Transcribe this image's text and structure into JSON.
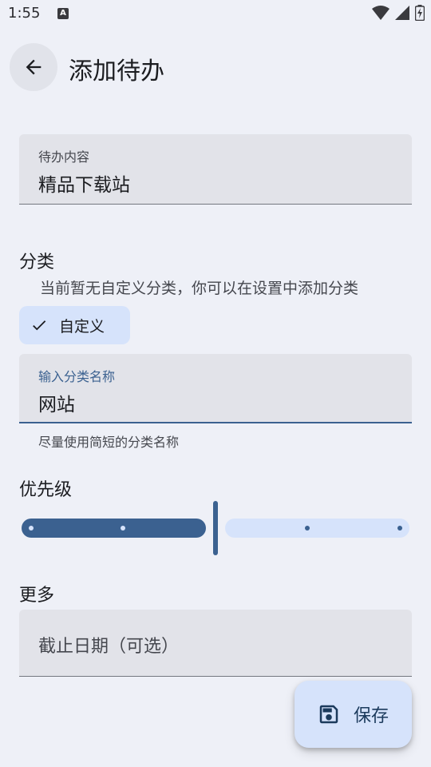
{
  "status_bar": {
    "time": "1:55",
    "a_icon": "A"
  },
  "header": {
    "title": "添加待办"
  },
  "todo_field": {
    "label": "待办内容",
    "value": "精品下载站"
  },
  "category": {
    "title": "分类",
    "hint": "当前暂无自定义分类，你可以在设置中添加分类",
    "chip_label": "自定义",
    "input_label": "输入分类名称",
    "input_value": "网站",
    "support_text": "尽量使用简短的分类名称"
  },
  "priority": {
    "title": "优先级",
    "steps": 5,
    "selected_index": 2
  },
  "more": {
    "title": "更多",
    "deadline_placeholder": "截止日期（可选）"
  },
  "fab": {
    "label": "保存"
  },
  "colors": {
    "accent": "#3b6190",
    "chip_bg": "#d6e3fb",
    "field_bg": "#e2e3e9",
    "page_bg": "#eef0f7"
  }
}
